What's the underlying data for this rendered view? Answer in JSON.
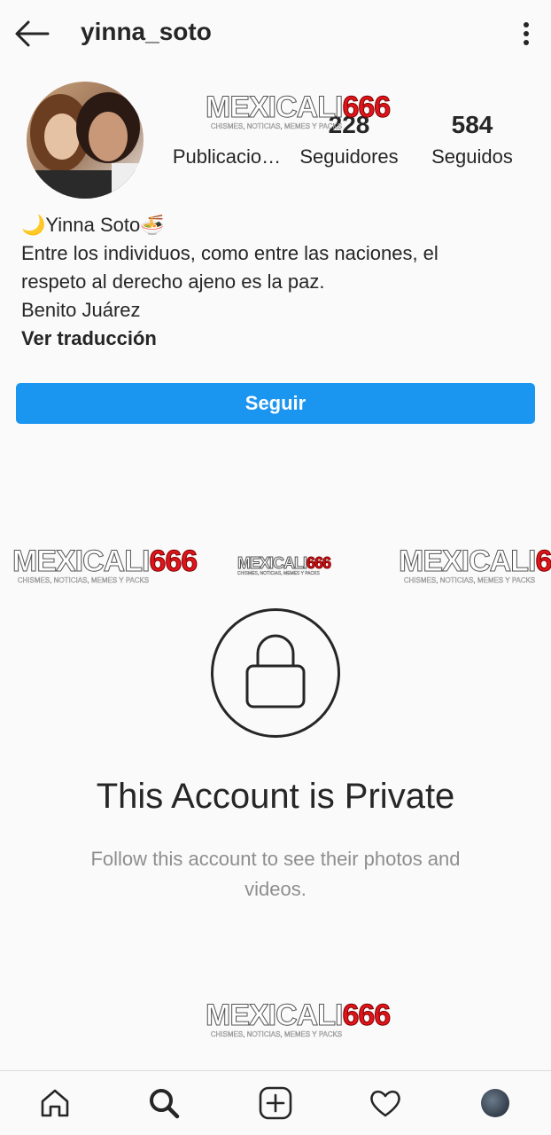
{
  "header": {
    "username": "yinna_soto"
  },
  "profile": {
    "stats": {
      "posts_number": "",
      "posts_label": "Publicacio…",
      "followers_number": "228",
      "followers_label": "Seguidores",
      "following_number": "584",
      "following_label": "Seguidos"
    },
    "display_name": "🌙Yinna Soto🍜",
    "bio_lines": [
      "Entre los individuos, como entre las naciones, el",
      "respeto al derecho ajeno es la paz.",
      "Benito Juárez"
    ],
    "translate_label": "Ver traducción",
    "follow_label": "Seguir"
  },
  "watermark": {
    "part1": "MEXICALI",
    "part2": "666",
    "tagline": "CHISMES, NOTICIAS, MEMES Y PACKS"
  },
  "private": {
    "title": "This Account is Private",
    "subtitle": "Follow this account to see their photos and videos."
  },
  "nav": {
    "items": [
      "home-icon",
      "search-icon",
      "new-post-icon",
      "activity-heart-icon",
      "profile-avatar"
    ]
  },
  "colors": {
    "accent": "#1a95f0",
    "background": "#fafafa",
    "text": "#262626",
    "muted": "#8e8e8e",
    "watermark_red": "#e1141b"
  }
}
